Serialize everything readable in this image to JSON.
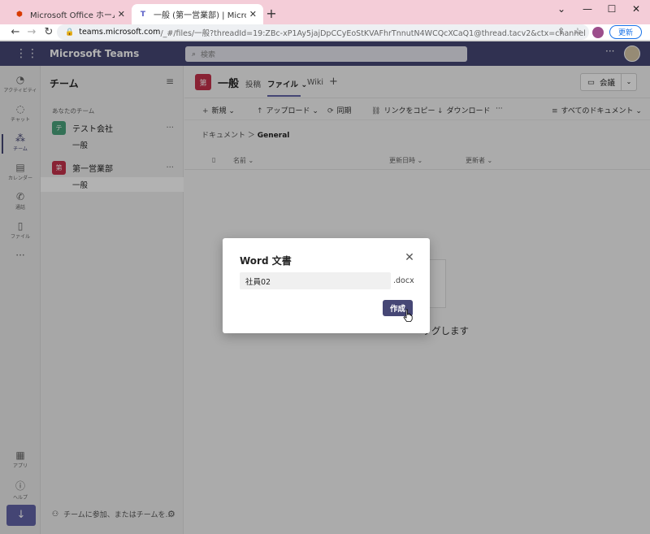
{
  "browser": {
    "tabs": [
      {
        "title": "Microsoft Office ホーム",
        "favicon": "office-icon",
        "active": false
      },
      {
        "title": "一般 (第一営業部) | Microsoft Tea",
        "favicon": "teams-icon",
        "active": true
      }
    ],
    "new_tab": "+",
    "window_controls": {
      "minimize": "⌄",
      "min": "—",
      "max": "☐",
      "close": "✕"
    },
    "url_host": "teams.microsoft.com",
    "url_path": "/_#/files/一般?threadId=19:ZBc-xP1Ay5jajDpCCyEoStKVAFhrTnnutN4WCQcXCaQ1@thread.tacv2&ctx=channel",
    "update_label": "更新"
  },
  "teams": {
    "app_title": "Microsoft Teams",
    "search_placeholder": "検索",
    "more": "···",
    "rail": [
      {
        "label": "アクティビティ",
        "icon": "bell-icon",
        "glyph": "🔔"
      },
      {
        "label": "チャット",
        "icon": "chat-icon",
        "glyph": "💬"
      },
      {
        "label": "チーム",
        "icon": "teams-icon",
        "glyph": "👥"
      },
      {
        "label": "カレンダー",
        "icon": "calendar-icon",
        "glyph": "📅"
      },
      {
        "label": "通話",
        "icon": "phone-icon",
        "glyph": "📞"
      },
      {
        "label": "ファイル",
        "icon": "file-icon",
        "glyph": "📄"
      },
      {
        "label": "···",
        "icon": "more-icon",
        "glyph": ""
      }
    ],
    "rail_bottom": [
      {
        "label": "アプリ",
        "icon": "apps-icon",
        "glyph": "▦"
      },
      {
        "label": "ヘルプ",
        "icon": "help-icon",
        "glyph": "?"
      }
    ],
    "download_glyph": "↓",
    "list_title": "チーム",
    "section_label": "あなたのチーム",
    "team_list": [
      {
        "name": "テスト会社",
        "initial": "テ",
        "color": "#4aa37c",
        "channel": "一般"
      },
      {
        "name": "第一営業部",
        "initial": "第",
        "color": "#c4314b",
        "channel": "一般"
      }
    ],
    "footer_text": "チームに参加、またはチームを…",
    "channel": {
      "icon_text": "第",
      "name": "一般",
      "tabs": [
        "投稿",
        "ファイル",
        "Wiki"
      ],
      "add_tab": "+",
      "meet_label": "会議"
    },
    "commands": [
      {
        "label": "新規",
        "icon": "+"
      },
      {
        "label": "アップロード",
        "icon": "↑"
      },
      {
        "label": "同期",
        "icon": "⟳"
      },
      {
        "label": "リンクをコピー",
        "icon": "🔗"
      },
      {
        "label": "ダウンロード",
        "icon": "↓"
      },
      {
        "label": "···",
        "icon": ""
      }
    ],
    "view_label": "すべてのドキュメント",
    "breadcrumb": {
      "root": "ドキュメント",
      "current": "General"
    },
    "columns": [
      "名前",
      "更新日時",
      "更新者"
    ],
    "empty_text": "ッグします"
  },
  "dialog": {
    "title": "Word 文書",
    "file_name": "社員02",
    "extension": ".docx",
    "create_label": "作成"
  }
}
